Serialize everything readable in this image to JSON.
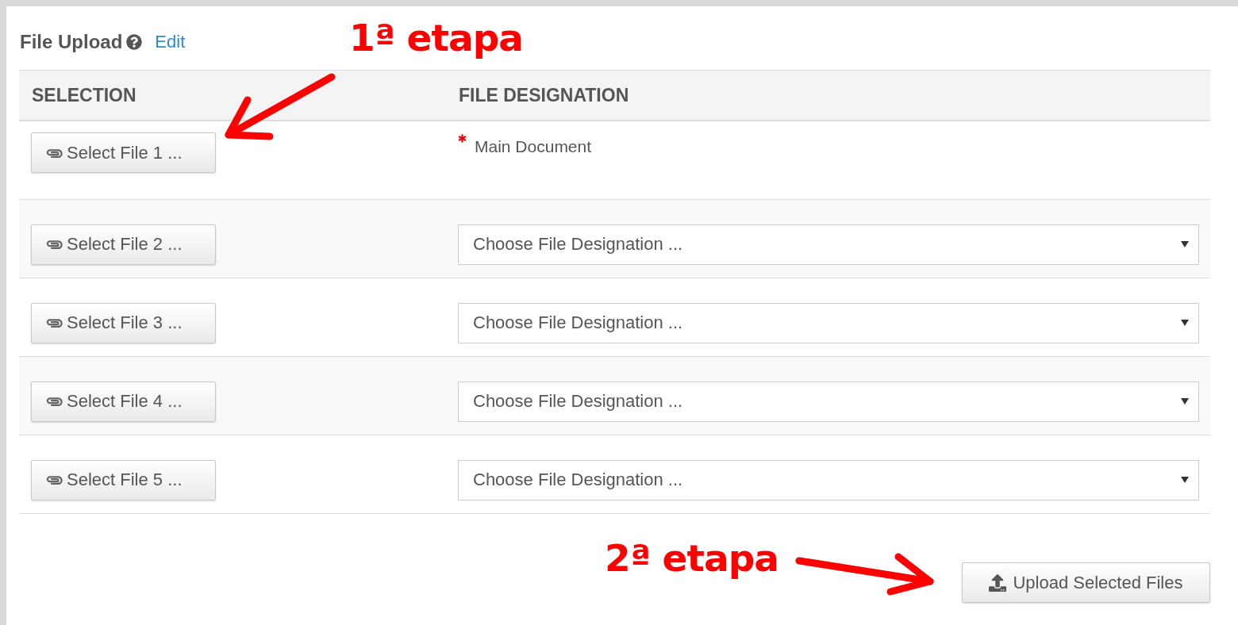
{
  "panel": {
    "title": "File Upload",
    "edit_link": "Edit"
  },
  "table": {
    "columns": [
      "SELECTION",
      "FILE DESIGNATION"
    ],
    "rows": [
      {
        "button": "Select File 1 ...",
        "kind": "label",
        "designation": "Main Document",
        "required": true
      },
      {
        "button": "Select File 2 ...",
        "kind": "select",
        "placeholder": "Choose File Designation ..."
      },
      {
        "button": "Select File 3 ...",
        "kind": "select",
        "placeholder": "Choose File Designation ..."
      },
      {
        "button": "Select File 4 ...",
        "kind": "select",
        "placeholder": "Choose File Designation ..."
      },
      {
        "button": "Select File 5 ...",
        "kind": "select",
        "placeholder": "Choose File Designation ..."
      }
    ]
  },
  "upload_button": "Upload Selected Files",
  "annotations": [
    {
      "text": "1ª etapa"
    },
    {
      "text": "2ª etapa"
    }
  ]
}
